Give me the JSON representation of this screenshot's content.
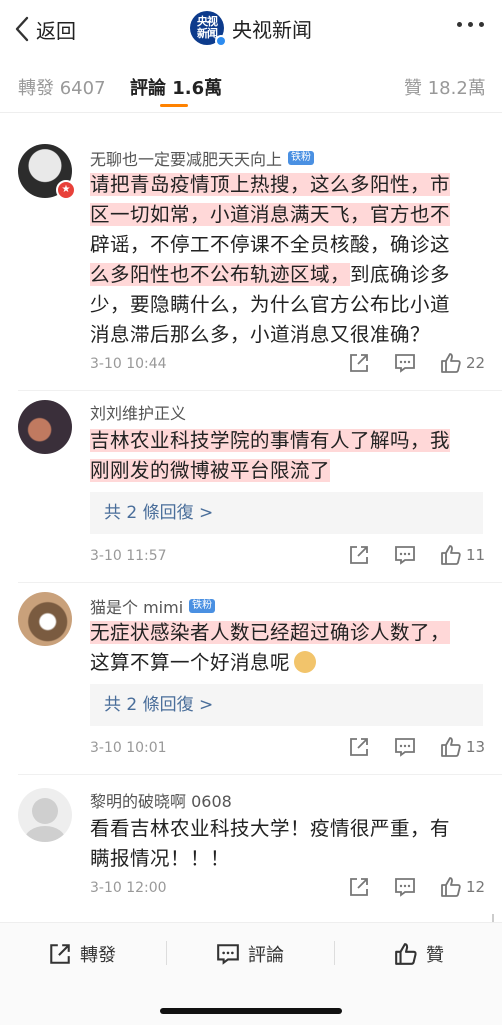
{
  "nav": {
    "back_label": "返回",
    "logo_text_line1": "央视",
    "logo_text_line2": "新闻",
    "title": "央视新闻",
    "more_icon": "more-horizontal-icon"
  },
  "tabs": [
    {
      "label": "轉發 6407"
    },
    {
      "label": "評論 1.6萬"
    },
    {
      "label": "贊 18.2萬"
    }
  ],
  "colors": {
    "accent": "#ff8200",
    "highlight": "#ffd8d8",
    "link": "#4a6e9a",
    "badge": "#4a90e2"
  },
  "comments": [
    {
      "username": "无聊也一定要减肥天天向上",
      "badge": "铁粉",
      "avatar_badge": "★",
      "lines": [
        "请把青岛疫情顶上热搜，这么多阳性，市",
        "区一切如常，小道消息满天飞，官方也不",
        "辟谣，不停工不停课不全员核酸，确诊这",
        "么多阳性也不公布轨迹区域，",
        "到底确诊多",
        "少，要隐瞒什么，为什么官方公布比小道",
        "消息滞后那么多，小道消息又很准确？"
      ],
      "time": "3-10 10:44",
      "likes": "22"
    },
    {
      "username": "刘刘维护正义",
      "lines": [
        "吉林农业科技学院的事情有人了解吗，我",
        "刚刚发的微博被平台限流了"
      ],
      "replies": "共 2 條回復 >",
      "time": "3-10 11:57",
      "likes": "11"
    },
    {
      "username": "猫是个 mimi",
      "badge": "铁粉",
      "lines": [
        "无症状感染者人数已经超过确诊人数了，",
        "这算不算一个好消息呢"
      ],
      "replies": "共 2 條回復 >",
      "time": "3-10 10:01",
      "likes": "13"
    },
    {
      "username": "黎明的破晓啊 0608",
      "lines": [
        "看看吉林农业科技大学！疫情很严重，有",
        "瞒报情况！！！"
      ],
      "time": "3-10 12:00",
      "likes": "12"
    }
  ],
  "bottom_bar": {
    "repost_label": "轉發",
    "comment_label": "評論",
    "like_label": "贊"
  }
}
